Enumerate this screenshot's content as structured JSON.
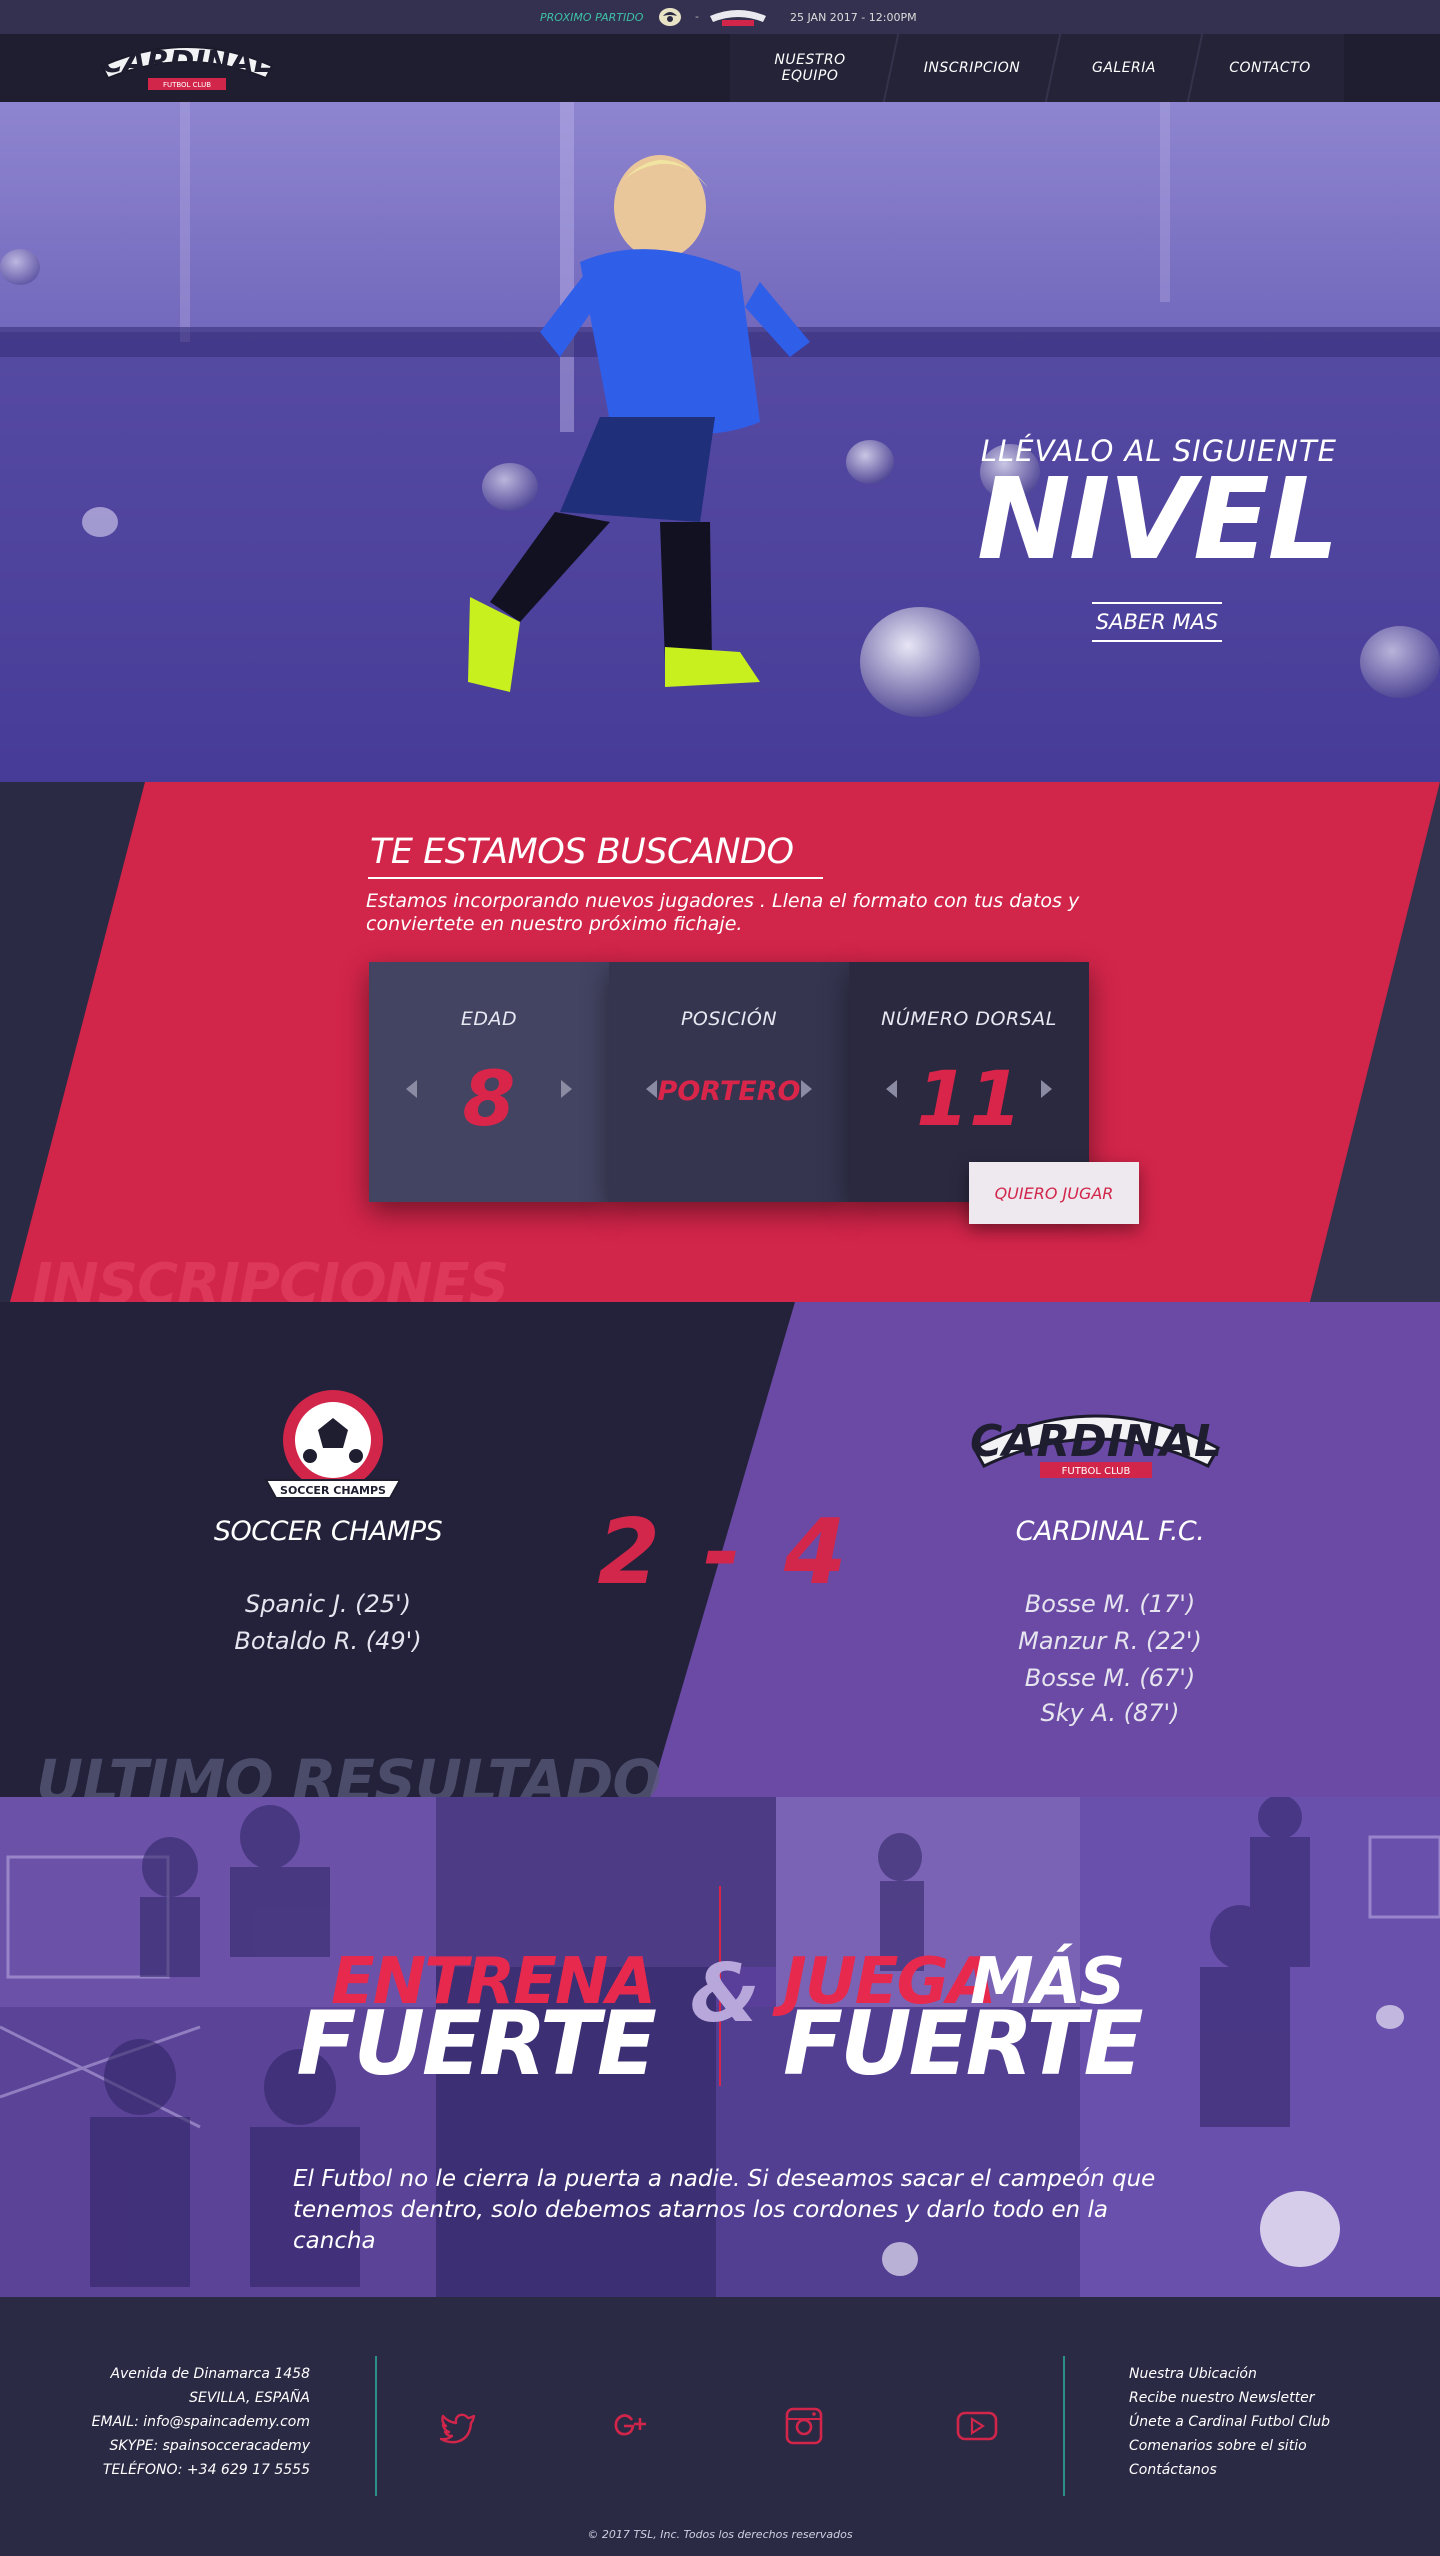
{
  "topbar": {
    "next_match_label": "PROXIMO PARTIDO",
    "separator": "-",
    "match_date": "25 JAN 2017 - 12:00PM"
  },
  "nav": {
    "logo_text": "CARDINAL",
    "logo_sub": "FUTBOL CLUB",
    "items": [
      {
        "label_line1": "NUESTRO",
        "label_line2": "EQUIPO"
      },
      {
        "label_line1": "INSCRIPCION"
      },
      {
        "label_line1": "GALERIA"
      },
      {
        "label_line1": "CONTACTO"
      }
    ]
  },
  "hero": {
    "subtitle": "LLÉVALO AL SIGUIENTE",
    "title": "NIVEL",
    "button": "SABER MAS"
  },
  "inscripciones": {
    "title": "TE ESTAMOS BUSCANDO",
    "description": "Estamos incorporando nuevos jugadores . Llena el formato con tus datos y conviertete en nuestro próximo fichaje.",
    "panels": [
      {
        "label": "EDAD",
        "value": "8"
      },
      {
        "label": "POSICIÓN",
        "value": "PORTERO"
      },
      {
        "label": "NÚMERO DORSAL",
        "value": "11"
      }
    ],
    "button": "QUIERO JUGAR",
    "ghost_label": "INSCRIPCIONES"
  },
  "resultado": {
    "home": {
      "badge_text": "SOCCER CHAMPS",
      "name": "SOCCER CHAMPS",
      "scorers": [
        "Spanic J. (25')",
        "Botaldo R. (49')"
      ]
    },
    "score": "2 - 4",
    "away": {
      "badge_text": "CARDINAL",
      "badge_sub": "FUTBOL CLUB",
      "name": "CARDINAL F.C.",
      "scorers": [
        "Bosse M. (17')",
        "Manzur R. (22')",
        "Bosse M. (67')",
        "Sky A. (87')"
      ]
    },
    "ghost_label": "ULTIMO RESULTADO"
  },
  "entrena": {
    "left_red": "ENTRENA",
    "left_white": "FUERTE",
    "amp": "&",
    "right_red": "JUEGA",
    "right_white_1": "MÁS",
    "right_white_2": "FUERTE",
    "description": "El Futbol no le cierra la puerta a nadie. Si deseamos sacar el campeón que tenemos dentro, solo debemos atarnos los cordones y darlo todo en la cancha"
  },
  "footer": {
    "address": [
      "Avenida de Dinamarca 1458",
      "SEVILLA, ESPAÑA",
      "EMAIL:  info@spaincademy.com",
      "SKYPE: spainsocceracademy",
      "TELÉFONO: +34 629 17 5555"
    ],
    "social_icons": [
      "twitter-icon",
      "google-plus-icon",
      "instagram-icon",
      "youtube-icon"
    ],
    "links": [
      "Nuestra Ubicación",
      "Recibe nuestro Newsletter",
      "Únete a Cardinal Futbol Club",
      "Comenarios sobre el sitio",
      "Contáctanos"
    ],
    "copyright": "© 2017 TSL, Inc. Todos los derechos reservados"
  },
  "colors": {
    "accent_red": "#d2254a",
    "teal": "#3ec1a7",
    "navy": "#2b2a45",
    "purple": "#6b4aa3"
  }
}
